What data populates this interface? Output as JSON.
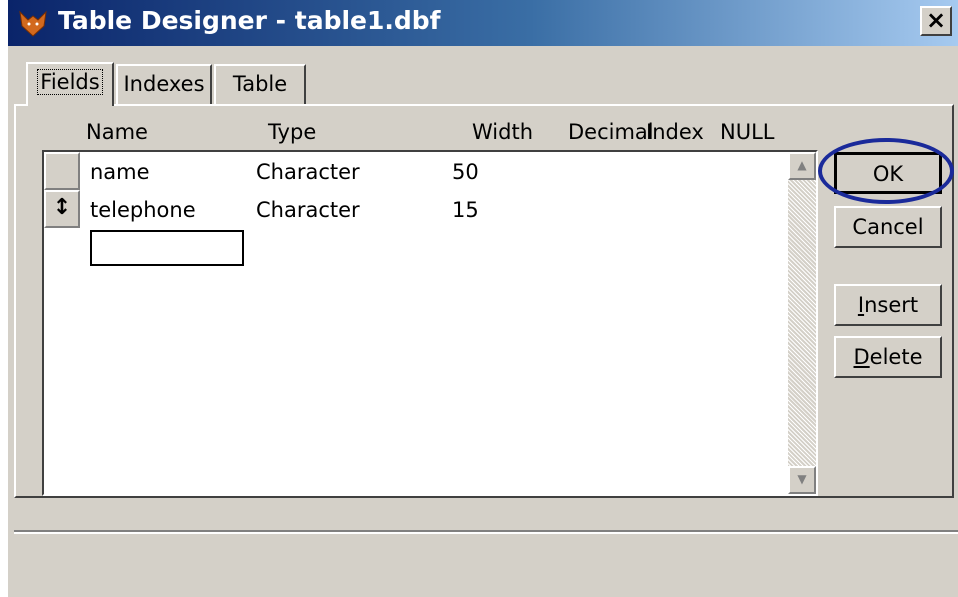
{
  "window": {
    "title": "Table Designer - table1.dbf",
    "close_label": "×"
  },
  "tabs": [
    {
      "label": "Fields",
      "active": true
    },
    {
      "label": "Indexes",
      "active": false
    },
    {
      "label": "Table",
      "active": false
    }
  ],
  "grid": {
    "columns": [
      "Name",
      "Type",
      "Width",
      "Decimal",
      "Index",
      "NULL"
    ],
    "rows": [
      {
        "name": "name",
        "type": "Character",
        "width": "50",
        "selector": ""
      },
      {
        "name": "telephone",
        "type": "Character",
        "width": "15",
        "selector": "↕"
      }
    ],
    "new_row_name": ""
  },
  "buttons": {
    "ok": "OK",
    "cancel": "Cancel",
    "insert": "Insert",
    "delete": "Delete"
  },
  "colors": {
    "titlebar_start": "#0a246a",
    "titlebar_end": "#a6caf0",
    "annotation_circle": "#1a2a9a",
    "dialog_bg": "#d4d0c8"
  },
  "icons": {
    "app": "foxpro-icon",
    "scroll_up": "scroll-up-arrow-icon",
    "scroll_down": "scroll-down-arrow-icon"
  }
}
